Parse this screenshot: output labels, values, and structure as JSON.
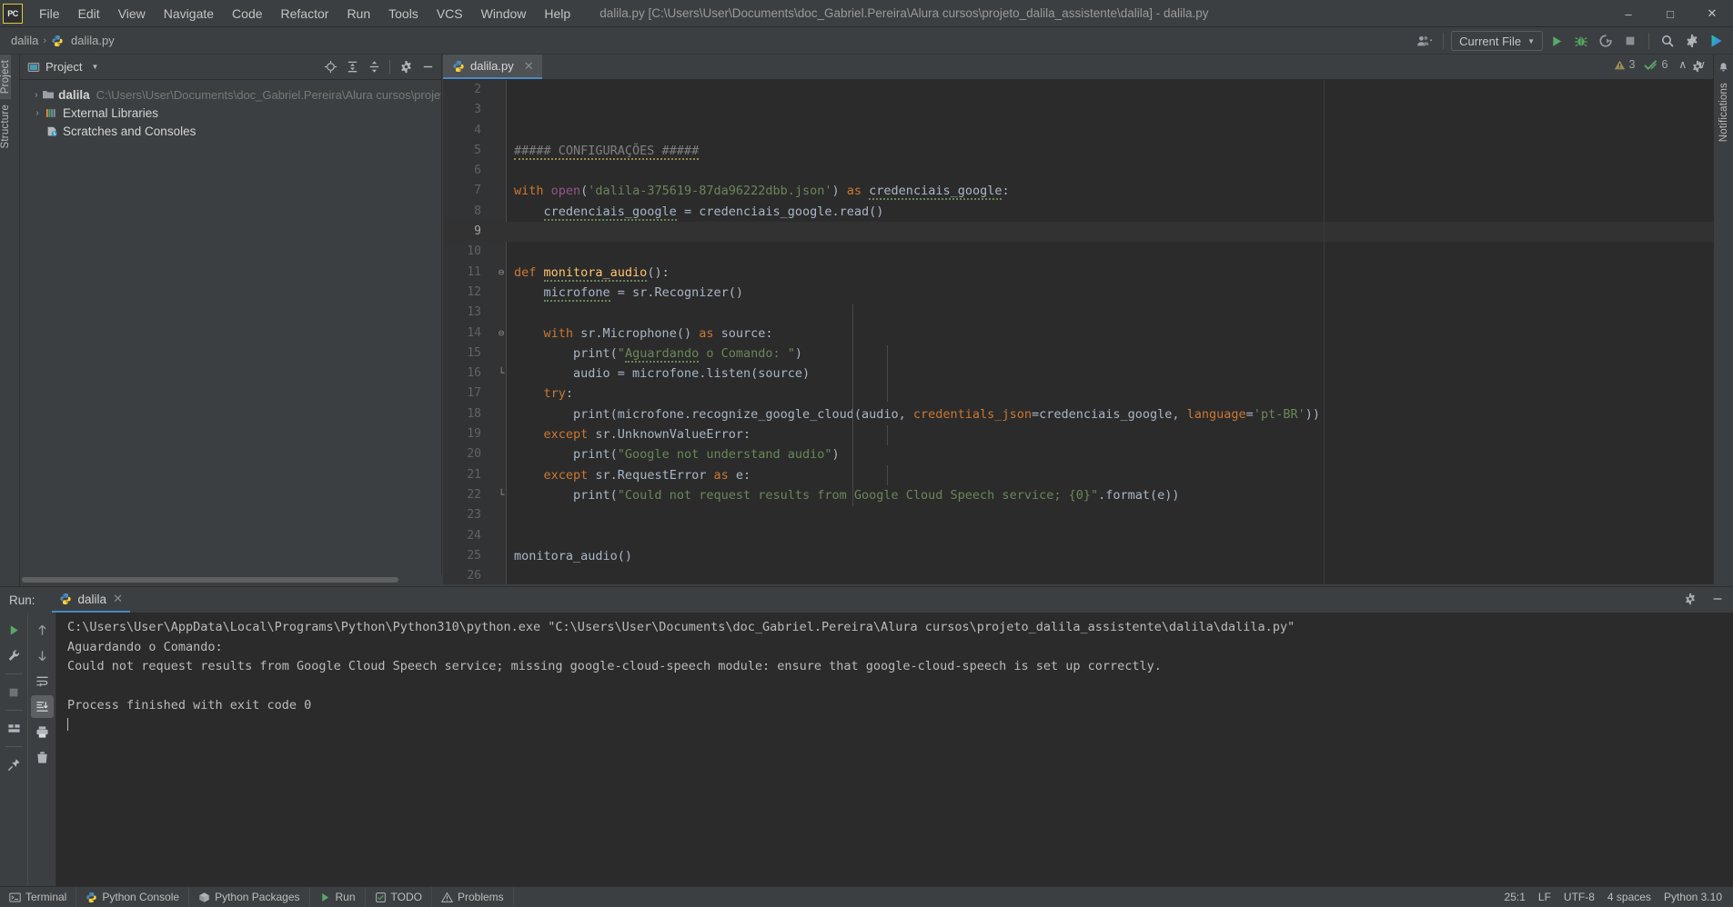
{
  "window": {
    "title": "dalila.py [C:\\Users\\User\\Documents\\doc_Gabriel.Pereira\\Alura cursos\\projeto_dalila_assistente\\dalila] - dalila.py",
    "logo": "PC",
    "minimize": "–",
    "maximize": "□",
    "close": "✕"
  },
  "menu": [
    {
      "label": "File"
    },
    {
      "label": "Edit"
    },
    {
      "label": "View"
    },
    {
      "label": "Navigate"
    },
    {
      "label": "Code"
    },
    {
      "label": "Refactor"
    },
    {
      "label": "Run"
    },
    {
      "label": "Tools"
    },
    {
      "label": "VCS"
    },
    {
      "label": "Window"
    },
    {
      "label": "Help"
    }
  ],
  "navbar": {
    "breadcrumbs": [
      "dalila",
      "dalila.py"
    ],
    "separator": "›",
    "run_config": "Current File",
    "dropdown_caret": "▼",
    "icons": [
      "user-avatar-icon",
      "run-icon",
      "debug-icon",
      "run-coverage-icon",
      "stop-icon",
      "search-everywhere-icon",
      "settings-icon",
      "ide-assistant-icon"
    ]
  },
  "project_panel": {
    "title": "Project",
    "caret": "▼",
    "header_icons": [
      "locate-icon",
      "expand-all-icon",
      "collapse-all-icon",
      "gear-icon",
      "hide-icon"
    ],
    "tree": [
      {
        "twisty": "›",
        "icon": "folder-icon",
        "label": "dalila",
        "bold": true,
        "sub": "C:\\Users\\User\\Documents\\doc_Gabriel.Pereira\\Alura cursos\\projeto_dalila_as"
      },
      {
        "twisty": "›",
        "icon": "libraries-icon",
        "label": "External Libraries",
        "bold": false,
        "sub": ""
      },
      {
        "twisty": "",
        "icon": "scratches-icon",
        "label": "Scratches and Consoles",
        "bold": false,
        "sub": ""
      }
    ]
  },
  "left_strip": [
    {
      "label": "Project",
      "active": true
    },
    {
      "label": "Structure",
      "active": false
    }
  ],
  "right_strip": {
    "label": "Notifications"
  },
  "editor": {
    "tab": {
      "label": "dalila.py",
      "icon": "python-file-icon",
      "close": "✕"
    },
    "tab_icons": [
      "settings-icon",
      "more-options-icon"
    ],
    "status": {
      "warning_icon": "warning-triangle-icon",
      "warning_count": "3",
      "inspection_icon": "inspection-check-icon",
      "inspection_count": "6",
      "prev": "∧",
      "next": "∨"
    },
    "first_visible_line": 2,
    "current_line": 9,
    "lines": [
      {
        "n": 2,
        "tokens": []
      },
      {
        "n": 3,
        "tokens": []
      },
      {
        "n": 4,
        "tokens": []
      },
      {
        "n": 5,
        "tokens": [
          {
            "t": "##### CONFIGURAÇÕES #####",
            "c": "c warn-u"
          }
        ]
      },
      {
        "n": 6,
        "tokens": []
      },
      {
        "n": 7,
        "tokens": [
          {
            "t": "with ",
            "c": "k"
          },
          {
            "t": "open",
            "c": "kw"
          },
          {
            "t": "(",
            "c": "id"
          },
          {
            "t": "'dalila-375619-87da96222dbb.json'",
            "c": "s"
          },
          {
            "t": ") ",
            "c": "id"
          },
          {
            "t": "as ",
            "c": "k"
          },
          {
            "t": "credenciais_google",
            "c": "id err-u"
          },
          {
            "t": ":",
            "c": "id"
          }
        ]
      },
      {
        "n": 8,
        "tokens": [
          {
            "t": "    ",
            "c": "id"
          },
          {
            "t": "credenciais_google",
            "c": "id err-u"
          },
          {
            "t": " = credenciais_google.read()",
            "c": "id"
          }
        ]
      },
      {
        "n": 9,
        "tokens": []
      },
      {
        "n": 10,
        "tokens": []
      },
      {
        "n": 11,
        "fold": "⊖",
        "tokens": [
          {
            "t": "def ",
            "c": "k"
          },
          {
            "t": "monitora_audio",
            "c": "fn err-u"
          },
          {
            "t": "():",
            "c": "id"
          }
        ]
      },
      {
        "n": 12,
        "tokens": [
          {
            "t": "    ",
            "c": "id"
          },
          {
            "t": "microfone",
            "c": "id err-u"
          },
          {
            "t": " = sr.Recognizer()",
            "c": "id"
          }
        ]
      },
      {
        "n": 13,
        "tokens": []
      },
      {
        "n": 14,
        "fold": "⊖",
        "tokens": [
          {
            "t": "    ",
            "c": "id"
          },
          {
            "t": "with ",
            "c": "k"
          },
          {
            "t": "sr.Microphone() ",
            "c": "id"
          },
          {
            "t": "as ",
            "c": "k"
          },
          {
            "t": "source:",
            "c": "id"
          }
        ]
      },
      {
        "n": 15,
        "tokens": [
          {
            "t": "        print(",
            "c": "id"
          },
          {
            "t": "\"",
            "c": "s"
          },
          {
            "t": "Aguardando",
            "c": "s err-u"
          },
          {
            "t": " o Comando: \"",
            "c": "s"
          },
          {
            "t": ")",
            "c": "id"
          }
        ]
      },
      {
        "n": 16,
        "fold": "└",
        "tokens": [
          {
            "t": "        audio = microfone.listen(source)",
            "c": "id"
          }
        ]
      },
      {
        "n": 17,
        "tokens": [
          {
            "t": "    ",
            "c": "id"
          },
          {
            "t": "try",
            "c": "k"
          },
          {
            "t": ":",
            "c": "id"
          }
        ]
      },
      {
        "n": 18,
        "tokens": [
          {
            "t": "        print(microfone.recognize_google_cloud(audio, ",
            "c": "id"
          },
          {
            "t": "credentials_json",
            "c": "na"
          },
          {
            "t": "=credenciais_google, ",
            "c": "id"
          },
          {
            "t": "language",
            "c": "na"
          },
          {
            "t": "=",
            "c": "id"
          },
          {
            "t": "'pt-BR'",
            "c": "s"
          },
          {
            "t": "))",
            "c": "id"
          }
        ]
      },
      {
        "n": 19,
        "tokens": [
          {
            "t": "    ",
            "c": "id"
          },
          {
            "t": "except ",
            "c": "k"
          },
          {
            "t": "sr.UnknownValueError:",
            "c": "id"
          }
        ]
      },
      {
        "n": 20,
        "tokens": [
          {
            "t": "        print(",
            "c": "id"
          },
          {
            "t": "\"Google not understand audio\"",
            "c": "s"
          },
          {
            "t": ")",
            "c": "id"
          }
        ]
      },
      {
        "n": 21,
        "tokens": [
          {
            "t": "    ",
            "c": "id"
          },
          {
            "t": "except ",
            "c": "k"
          },
          {
            "t": "sr.RequestError ",
            "c": "id"
          },
          {
            "t": "as ",
            "c": "k"
          },
          {
            "t": "e:",
            "c": "id"
          }
        ]
      },
      {
        "n": 22,
        "fold": "└",
        "tokens": [
          {
            "t": "        print(",
            "c": "id"
          },
          {
            "t": "\"Could not request results from Google Cloud Speech service; {0}\"",
            "c": "s"
          },
          {
            "t": ".format(e))",
            "c": "id"
          }
        ]
      },
      {
        "n": 23,
        "tokens": []
      },
      {
        "n": 24,
        "tokens": []
      },
      {
        "n": 25,
        "tokens": [
          {
            "t": "monitora_audio()",
            "c": "id"
          }
        ]
      },
      {
        "n": 26,
        "tokens": []
      }
    ]
  },
  "run_panel": {
    "label": "Run:",
    "tab": {
      "label": "dalila",
      "icon": "python-run-icon",
      "close": "✕"
    },
    "header_icons": [
      "settings-icon",
      "hide-icon"
    ],
    "toolbar_left": [
      "rerun-icon",
      "wrench-icon",
      "stop-icon",
      "layout-icon",
      "pin-icon"
    ],
    "toolbar_right": [
      "scroll-up-icon",
      "scroll-down-icon",
      "soft-wrap-icon",
      "scroll-to-end-icon",
      "print-icon",
      "clear-all-icon"
    ],
    "console": [
      "C:\\Users\\User\\AppData\\Local\\Programs\\Python\\Python310\\python.exe \"C:\\Users\\User\\Documents\\doc_Gabriel.Pereira\\Alura cursos\\projeto_dalila_assistente\\dalila\\dalila.py\"",
      "Aguardando o Comando:",
      "Could not request results from Google Cloud Speech service; missing google-cloud-speech module: ensure that google-cloud-speech is set up correctly.",
      "",
      "Process finished with exit code 0"
    ]
  },
  "status_bar": {
    "tools": [
      {
        "icon": "terminal-icon",
        "label": "Terminal"
      },
      {
        "icon": "python-console-icon",
        "label": "Python Console"
      },
      {
        "icon": "python-packages-icon",
        "label": "Python Packages"
      },
      {
        "icon": "run-icon",
        "label": "Run"
      },
      {
        "icon": "todo-icon",
        "label": "TODO"
      },
      {
        "icon": "problems-icon",
        "label": "Problems"
      }
    ],
    "right": [
      {
        "label": "25:1"
      },
      {
        "label": "LF"
      },
      {
        "label": "UTF-8"
      },
      {
        "label": "4 spaces"
      },
      {
        "label": "Python 3.10"
      }
    ]
  },
  "colors": {
    "accent": "#4a88c7",
    "panel_bg": "#3c3f41",
    "editor_bg": "#2b2b2b",
    "gutter_bg": "#313335",
    "run_green": "#5a9e4b",
    "keyword_orange": "#cc7832",
    "string_green": "#6a8759",
    "function_yellow": "#ffc66d",
    "identifier_blue": "#a9b7c6"
  }
}
